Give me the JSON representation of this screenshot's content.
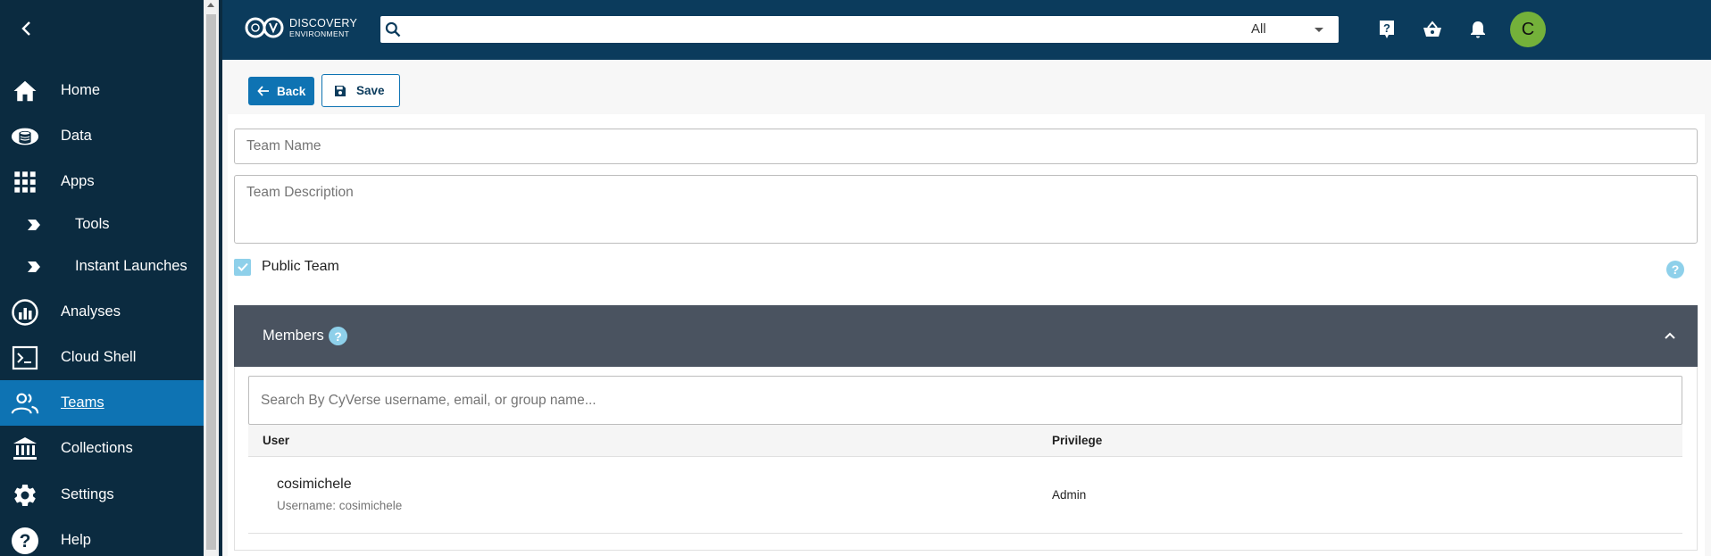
{
  "app": {
    "logo_line1": "DISCOVERY",
    "logo_line2": "ENVIRONMENT"
  },
  "search": {
    "value": "",
    "scope_selected": "All"
  },
  "sidebar": {
    "items": [
      {
        "label": "Home",
        "icon": "home-icon"
      },
      {
        "label": "Data",
        "icon": "data-icon"
      },
      {
        "label": "Apps",
        "icon": "apps-grid-icon"
      },
      {
        "label": "Tools",
        "icon": "chevron-tag-icon"
      },
      {
        "label": "Instant Launches",
        "icon": "chevron-tag-icon"
      },
      {
        "label": "Analyses",
        "icon": "analyses-icon"
      },
      {
        "label": "Cloud Shell",
        "icon": "terminal-icon"
      },
      {
        "label": "Teams",
        "icon": "teams-icon",
        "active": true
      },
      {
        "label": "Collections",
        "icon": "collections-icon"
      },
      {
        "label": "Settings",
        "icon": "gear-icon"
      },
      {
        "label": "Help",
        "icon": "help-icon"
      }
    ]
  },
  "header": {
    "avatar_letter": "C"
  },
  "toolbar": {
    "back_label": "Back",
    "save_label": "Save"
  },
  "form": {
    "team_name_placeholder": "Team Name",
    "team_description_placeholder": "Team Description",
    "public_team_label": "Public Team",
    "public_team_checked": true
  },
  "members": {
    "title": "Members",
    "search_placeholder": "Search By CyVerse username, email, or group name...",
    "columns": [
      "User",
      "Privilege"
    ],
    "rows": [
      {
        "name": "cosimichele",
        "username": "Username: cosimichele",
        "privilege": "Admin"
      }
    ]
  },
  "colors": {
    "sidebar_bg": "#0b2b40",
    "topbar_bg": "#0b3b5c",
    "accent": "#0e73b3",
    "members_header_bg": "#4a5360",
    "avatar_bg": "#74b13a",
    "help_icon": "#8ed0ea"
  }
}
